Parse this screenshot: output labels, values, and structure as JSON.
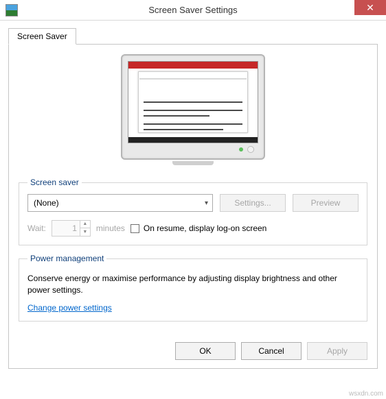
{
  "window": {
    "title": "Screen Saver Settings"
  },
  "tabs": {
    "screensaver": "Screen Saver"
  },
  "groups": {
    "screensaver": {
      "legend": "Screen saver",
      "selected": "(None)",
      "settings_btn": "Settings...",
      "preview_btn": "Preview",
      "wait_label": "Wait:",
      "wait_value": "1",
      "minutes_label": "minutes",
      "resume_label": "On resume, display log-on screen"
    },
    "power": {
      "legend": "Power management",
      "text": "Conserve energy or maximise performance by adjusting display brightness and other power settings.",
      "link": "Change power settings"
    }
  },
  "footer": {
    "ok": "OK",
    "cancel": "Cancel",
    "apply": "Apply"
  },
  "watermark": "wsxdn.com"
}
